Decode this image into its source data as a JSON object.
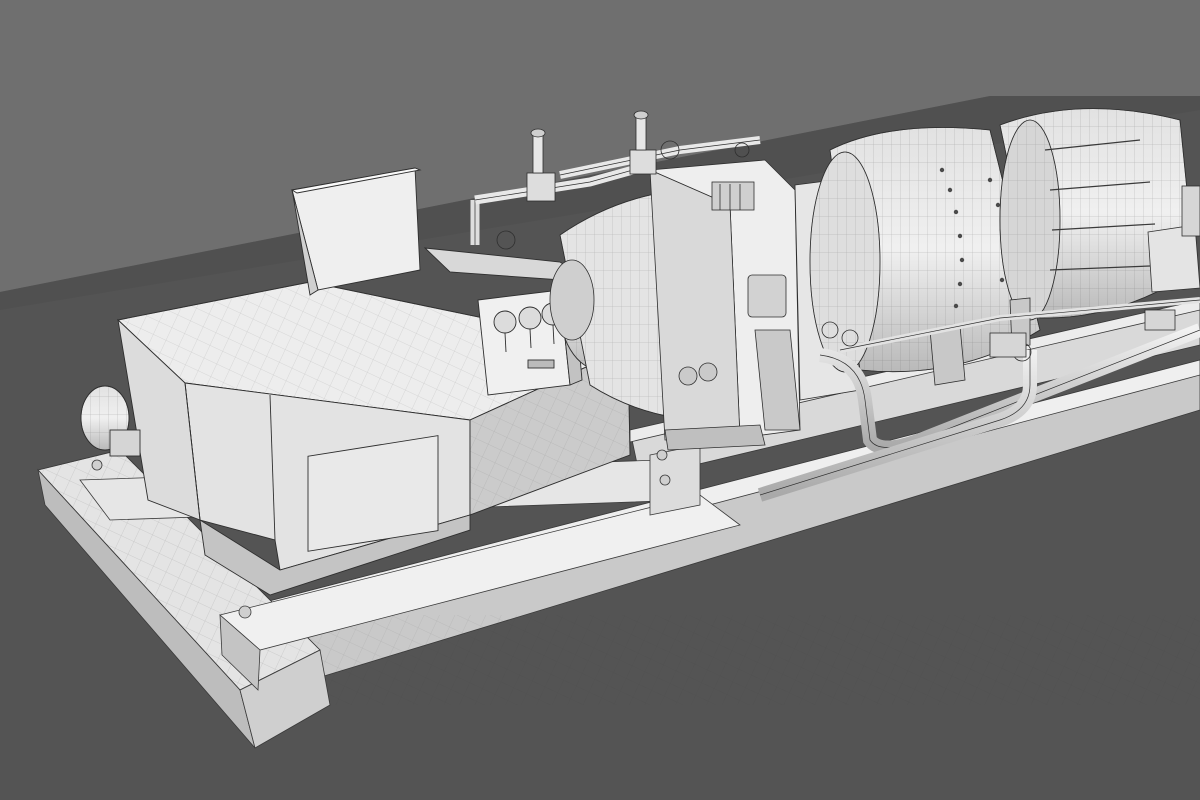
{
  "scene": {
    "subject": "gas-turbine-generator-skid-wireframe-render",
    "colors": {
      "backdrop": "#6f6f6f",
      "floor": "#545454",
      "floor_far": "#4e4e4e",
      "metal_light": "#ececec",
      "metal_mid": "#d6d6d6",
      "metal_shadow": "#b8b8b8",
      "metal_dark": "#8f8f8f",
      "wire": "#3a3a3a"
    },
    "components": [
      "skid-base-frame",
      "generator-enclosure",
      "junction-box",
      "gauge-panel",
      "turbine-casing",
      "exhaust-collector",
      "piping",
      "valves"
    ]
  }
}
